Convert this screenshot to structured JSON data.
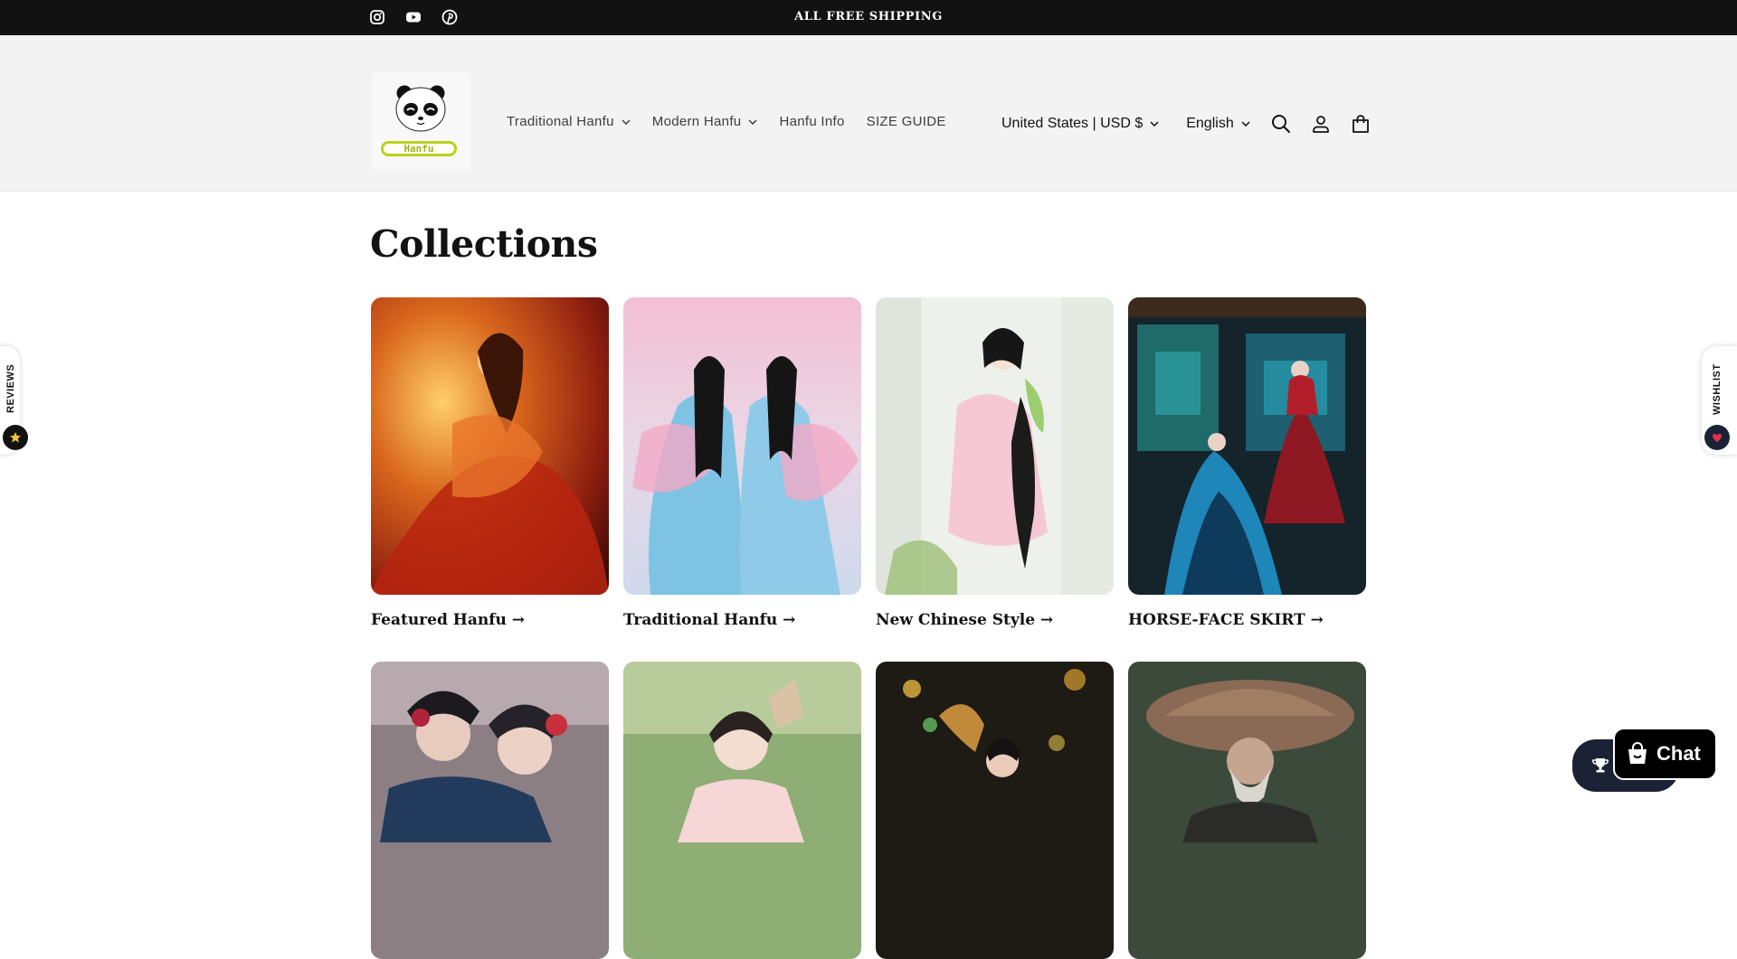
{
  "announcement": "ALL FREE SHIPPING",
  "social_icons": [
    "instagram-icon",
    "youtube-icon",
    "pinterest-icon"
  ],
  "logo": {
    "tag_text": "Hanfu"
  },
  "nav": {
    "items": [
      {
        "label": "Traditional Hanfu",
        "has_dropdown": true
      },
      {
        "label": "Modern Hanfu",
        "has_dropdown": true
      },
      {
        "label": "Hanfu Info",
        "has_dropdown": false
      },
      {
        "label": "SIZE GUIDE",
        "has_dropdown": false
      }
    ]
  },
  "localization": {
    "country": "United States | USD $",
    "language": "English"
  },
  "header_icons": [
    "search-icon",
    "account-icon",
    "cart-icon"
  ],
  "page_title": "Collections",
  "collections": [
    {
      "label": "Featured Hanfu →"
    },
    {
      "label": "Traditional Hanfu →"
    },
    {
      "label": "New Chinese Style →"
    },
    {
      "label": "HORSE-FACE SKIRT →"
    }
  ],
  "side_tabs": {
    "reviews": "REVIEWS",
    "wishlist": "WISHLIST"
  },
  "chat": {
    "label": "Chat"
  },
  "colors": {
    "topbar": "#121212",
    "header_bg": "#f3f3f3",
    "logo_accent": "#b9d21a",
    "chat_bg": "#000000",
    "rewards_bg": "#1b2236"
  }
}
